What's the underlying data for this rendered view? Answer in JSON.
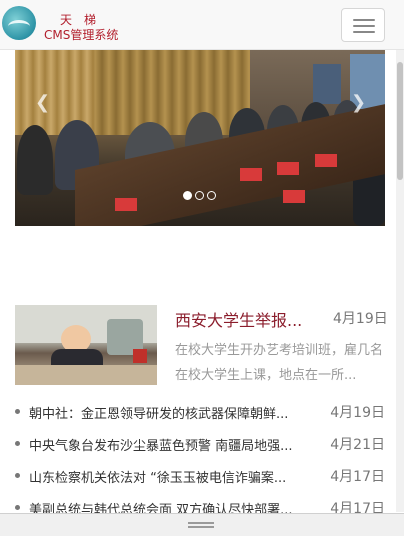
{
  "header": {
    "logo_cn": "天梯",
    "logo_en": "CMS管理系统",
    "menu_icon": "hamburger-menu-icon"
  },
  "banner": {
    "prev_icon": "chevron-left-icon",
    "next_icon": "chevron-right-icon",
    "prev_glyph": "❮",
    "next_glyph": "❯",
    "slide_count": 3,
    "active_slide": 1
  },
  "featured": {
    "title": "西安大学生举报...",
    "date": "4月19日",
    "description": "在校大学生开办艺考培训班，雇几名在校大学生上课，地点在一所..."
  },
  "news": [
    {
      "title": "朝中社：金正恩领导研发的核武器保障朝鲜...",
      "date": "4月19日"
    },
    {
      "title": "中央气象台发布沙尘暴蓝色预警 南疆局地强...",
      "date": "4月21日"
    },
    {
      "title": "山东检察机关依法对 “徐玉玉被电信诈骗案...",
      "date": "4月17日"
    },
    {
      "title": "美副总统与韩代总统会面 双方确认尽快部署...",
      "date": "4月17日"
    }
  ],
  "colors": {
    "accent": "#8b1d2c",
    "logo_red": "#b21f2d"
  }
}
